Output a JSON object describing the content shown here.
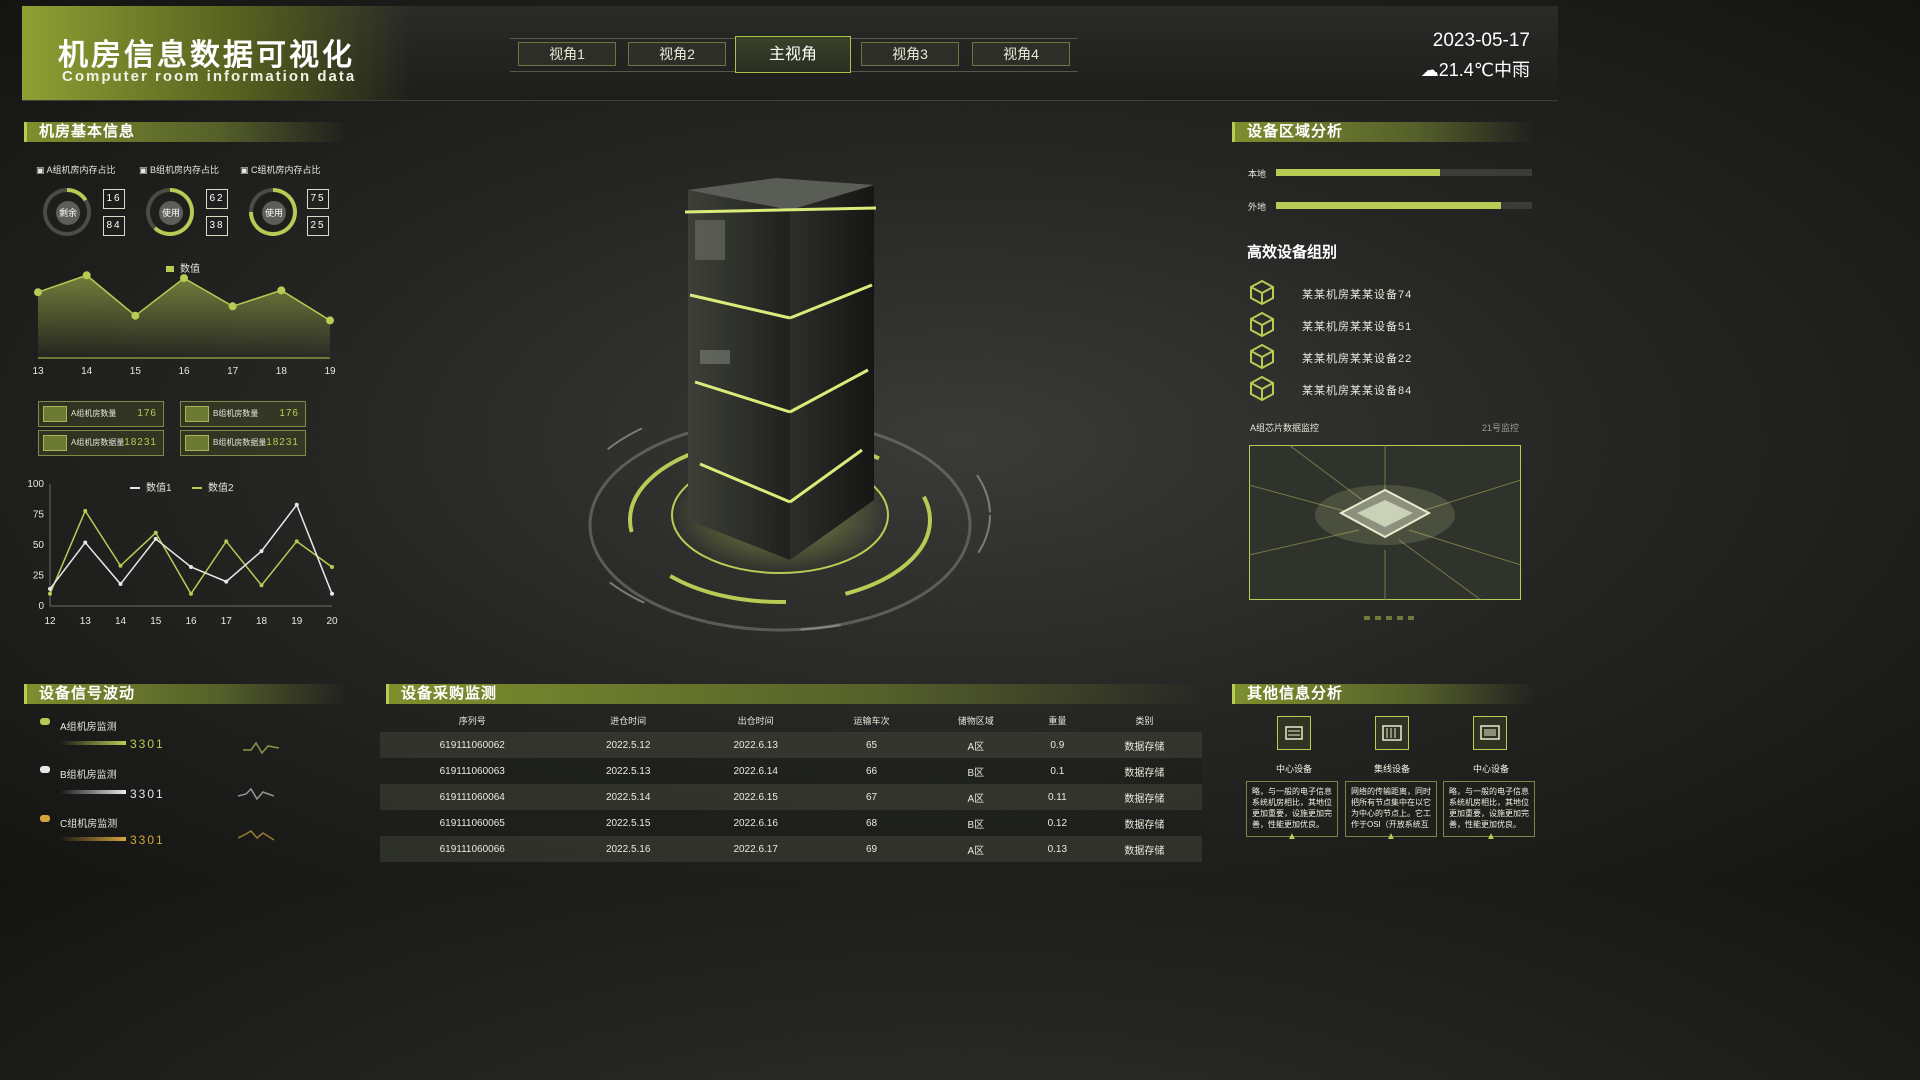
{
  "header": {
    "title_cn": "机房信息数据可视化",
    "title_en": "Computer room information data",
    "tabs": [
      "视角1",
      "视角2",
      "主视角",
      "视角3",
      "视角4"
    ],
    "date": "2023-05-17",
    "weather": "21.4℃中雨",
    "weather_icon": "cloud-rain-icon"
  },
  "basic_info": {
    "title": "机房基本信息",
    "groups": [
      {
        "label": "A组机房内存占比",
        "center": "剩余",
        "digits": [
          "16",
          "84"
        ],
        "fraction": 0.16
      },
      {
        "label": "B组机房内存占比",
        "center": "使用",
        "digits": [
          "62",
          "38"
        ],
        "fraction": 0.62
      },
      {
        "label": "C组机房内存占比",
        "center": "使用",
        "digits": [
          "75",
          "25"
        ],
        "fraction": 0.75
      }
    ],
    "line_legend": "数值",
    "stats": [
      {
        "label": "A组机房数量",
        "value": "176"
      },
      {
        "label": "B组机房数量",
        "value": "176"
      },
      {
        "label": "A组机房数据量",
        "value": "18231"
      },
      {
        "label": "B组机房数据量",
        "value": "18231"
      }
    ],
    "legend2": [
      "数值1",
      "数值2"
    ]
  },
  "chart_data": [
    {
      "type": "area",
      "series": [
        {
          "name": "数值",
          "values": [
            70,
            88,
            45,
            85,
            55,
            72,
            40
          ]
        }
      ],
      "x": [
        "13",
        "14",
        "15",
        "16",
        "17",
        "18",
        "19"
      ],
      "xlabel": "",
      "ylabel": "",
      "legend": "top",
      "color": "#b6cc54"
    },
    {
      "type": "line",
      "x": [
        "12",
        "13",
        "14",
        "15",
        "16",
        "17",
        "18",
        "19",
        "20"
      ],
      "series": [
        {
          "name": "数值1",
          "values": [
            10,
            78,
            33,
            60,
            10,
            53,
            17,
            53,
            32
          ],
          "color": "#b6cc54"
        },
        {
          "name": "数值2",
          "values": [
            14,
            52,
            18,
            55,
            32,
            20,
            45,
            83,
            10
          ],
          "color": "#e8e8e8"
        }
      ],
      "ylim": [
        0,
        100
      ],
      "yticks": [
        "0",
        "25",
        "50",
        "75",
        "100"
      ]
    }
  ],
  "region": {
    "title": "设备区域分析",
    "bars": [
      {
        "label": "本地",
        "fraction": 0.64
      },
      {
        "label": "外地",
        "fraction": 0.88
      }
    ],
    "efficient_title": "高效设备组别",
    "devices": [
      "某某机房某某设备74",
      "某某机房某某设备51",
      "某某机房某某设备22",
      "某某机房某某设备84"
    ],
    "monitor_label": "A组芯片数据监控",
    "monitor_id": "21号监控"
  },
  "signal": {
    "title": "设备信号波动",
    "items": [
      {
        "label": "A组机房监测",
        "value": "3301",
        "color": "#b6cc54"
      },
      {
        "label": "B组机房监测",
        "value": "3301",
        "color": "#e8e8e8"
      },
      {
        "label": "C组机房监测",
        "value": "3301",
        "color": "#d4a53a"
      }
    ]
  },
  "purchase": {
    "title": "设备采购监测",
    "columns": [
      "序列号",
      "进仓时间",
      "出仓时间",
      "运输车次",
      "储物区域",
      "重量",
      "类别"
    ],
    "rows": [
      [
        "619111060062",
        "2022.5.12",
        "2022.6.13",
        "65",
        "A区",
        "0.9",
        "数据存储"
      ],
      [
        "619111060063",
        "2022.5.13",
        "2022.6.14",
        "66",
        "B区",
        "0.1",
        "数据存储"
      ],
      [
        "619111060064",
        "2022.5.14",
        "2022.6.15",
        "67",
        "A区",
        "0.11",
        "数据存储"
      ],
      [
        "619111060065",
        "2022.5.15",
        "2022.6.16",
        "68",
        "B区",
        "0.12",
        "数据存储"
      ],
      [
        "619111060066",
        "2022.5.16",
        "2022.6.17",
        "69",
        "A区",
        "0.13",
        "数据存储"
      ]
    ]
  },
  "other": {
    "title": "其他信息分析",
    "cards": [
      {
        "title": "中心设备",
        "icon": "server-icon",
        "text": "略，与一般的电子信息系统机房相比，其地位更加重要，设施更加完善，性能更加优良。"
      },
      {
        "title": "集线设备",
        "icon": "hub-icon",
        "text": "网络的传输距离，同时把所有节点集中在以它为中心的节点上。它工作于OSI（开放系统互"
      },
      {
        "title": "中心设备",
        "icon": "monitor-icon",
        "text": "略，与一般的电子信息系统机房相比，其地位更加重要，设施更加完善，性能更加优良。"
      }
    ]
  }
}
